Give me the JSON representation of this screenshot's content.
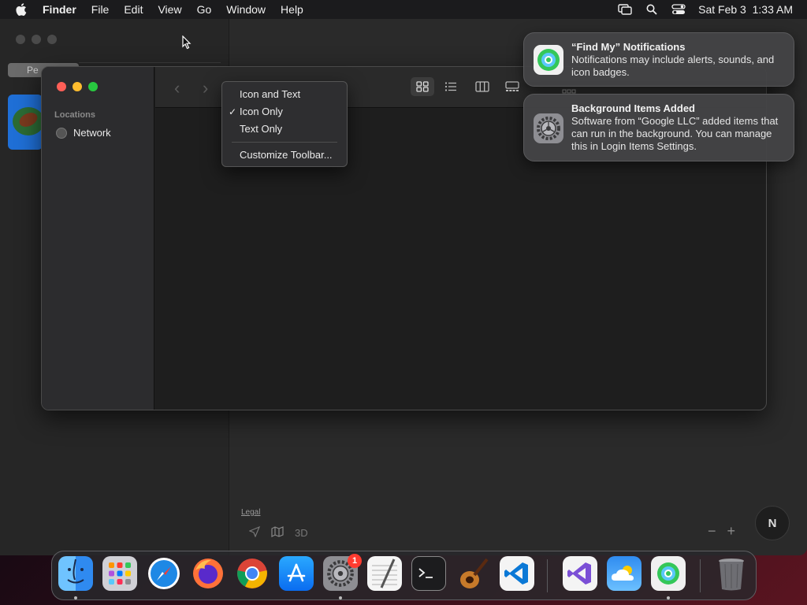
{
  "menubar": {
    "app_name": "Finder",
    "items": [
      "File",
      "Edit",
      "View",
      "Go",
      "Window",
      "Help"
    ],
    "clock": "Sat Feb 3  1:33 AM"
  },
  "maps": {
    "tab_label": "Pe",
    "legal": "Legal",
    "mode_3d": "3D",
    "zoom_out": "−",
    "zoom_in": "+",
    "compass": "N"
  },
  "finder": {
    "sidebar_heading": "Locations",
    "sidebar_items": [
      {
        "label": "Network",
        "icon": "globe-icon"
      }
    ],
    "nav_back": "‹",
    "nav_forward": "›"
  },
  "context_menu": {
    "items": [
      {
        "label": "Icon and Text",
        "checked": false
      },
      {
        "label": "Icon Only",
        "checked": true
      },
      {
        "label": "Text Only",
        "checked": false
      }
    ],
    "after_separator": "Customize Toolbar...",
    "check_glyph": "✓"
  },
  "notifications": [
    {
      "title": "“Find My” Notifications",
      "body": "Notifications may include alerts, sounds, and icon badges.",
      "icon": "find-my-icon"
    },
    {
      "title": "Background Items Added",
      "body": "Software from “Google LLC” added items that can run in the background. You can manage this in Login Items Settings.",
      "icon": "settings-gear-icon"
    }
  ],
  "dock": {
    "apps": [
      "Finder",
      "Launchpad",
      "Safari",
      "Firefox",
      "Chrome",
      "App Store",
      "System Settings",
      "TextEdit",
      "Terminal",
      "GarageBand",
      "Visual Studio Code",
      "Visual Studio",
      "Weather",
      "Find My",
      "Trash"
    ],
    "settings_badge": "1"
  },
  "colors": {
    "menubar_bg": "#1b1b1d",
    "finder_bg": "#1e1e1e",
    "notification_bg": "#444446",
    "badge": "#ff3b30"
  }
}
